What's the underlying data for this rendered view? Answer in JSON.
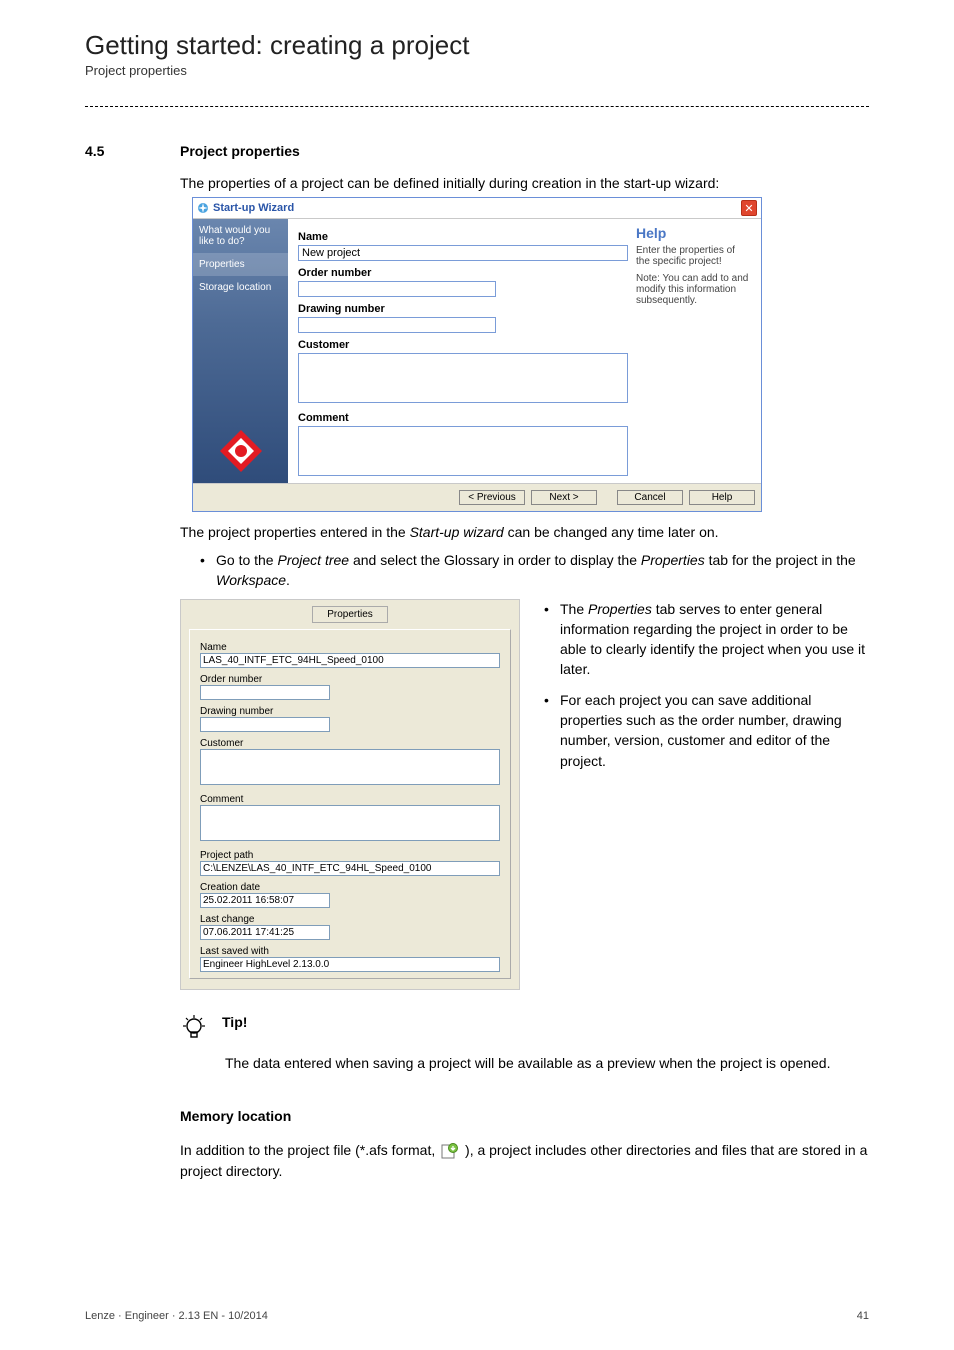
{
  "header": {
    "title": "Getting started: creating a project",
    "subtitle": "Project properties"
  },
  "section": {
    "number": "4.5",
    "title": "Project properties",
    "intro": "The properties of a project can be defined initially during creation in the start-up wizard:"
  },
  "wizard": {
    "title": "Start-up Wizard",
    "side": {
      "step1": "What would you like to do?",
      "step2": "Properties",
      "step3": "Storage location"
    },
    "form": {
      "name_label": "Name",
      "name_value": "New project",
      "order_label": "Order number",
      "order_value": "",
      "drawing_label": "Drawing number",
      "drawing_value": "",
      "customer_label": "Customer",
      "customer_value": "",
      "comment_label": "Comment",
      "comment_value": ""
    },
    "help": {
      "title": "Help",
      "line1": "Enter the properties of the specific project!",
      "line2": "Note: You can add to and modify this information subsequently."
    },
    "buttons": {
      "prev": "< Previous",
      "next": "Next >",
      "cancel": "Cancel",
      "help": "Help"
    }
  },
  "after_wizard": "The project properties entered in the Start-up wizard can be changed any time later on.",
  "bullet1_a": "Go to the ",
  "bullet1_b": "Project tree",
  "bullet1_c": " and select the Glossary in order to display the ",
  "bullet1_d": "Properties",
  "bullet1_e": " tab for the project in the ",
  "bullet1_f": "Workspace",
  "bullet1_g": ".",
  "panel": {
    "tab": "Properties",
    "name_label": "Name",
    "name_value": "LAS_40_INTF_ETC_94HL_Speed_0100",
    "order_label": "Order number",
    "order_value": "",
    "drawing_label": "Drawing number",
    "drawing_value": "",
    "customer_label": "Customer",
    "customer_value": "",
    "comment_label": "Comment",
    "comment_value": "",
    "path_label": "Project path",
    "path_value": "C:\\LENZE\\LAS_40_INTF_ETC_94HL_Speed_0100",
    "creation_label": "Creation date",
    "creation_value": "25.02.2011 16:58:07",
    "change_label": "Last change",
    "change_value": "07.06.2011 17:41:25",
    "saved_label": "Last saved with",
    "saved_value": "Engineer HighLevel 2.13.0.0"
  },
  "right": {
    "b1a": "The ",
    "b1b": "Properties",
    "b1c": " tab serves to enter general information regarding the project in order to be able to clearly identify the project when you use it later.",
    "b2": "For each project you can save additional properties such as the order number, drawing number, version, customer and editor of the project."
  },
  "tip": {
    "title": "Tip!",
    "text": "The data entered when saving a project will be available as a preview when the project is opened."
  },
  "memory": {
    "title": "Memory location",
    "text_a": "In addition to the project file (*.afs format, ",
    "text_b": "), a project includes other directories and files that are stored in a project directory."
  },
  "footer": {
    "left": "Lenze · Engineer · 2.13 EN - 10/2014",
    "right": "41"
  }
}
